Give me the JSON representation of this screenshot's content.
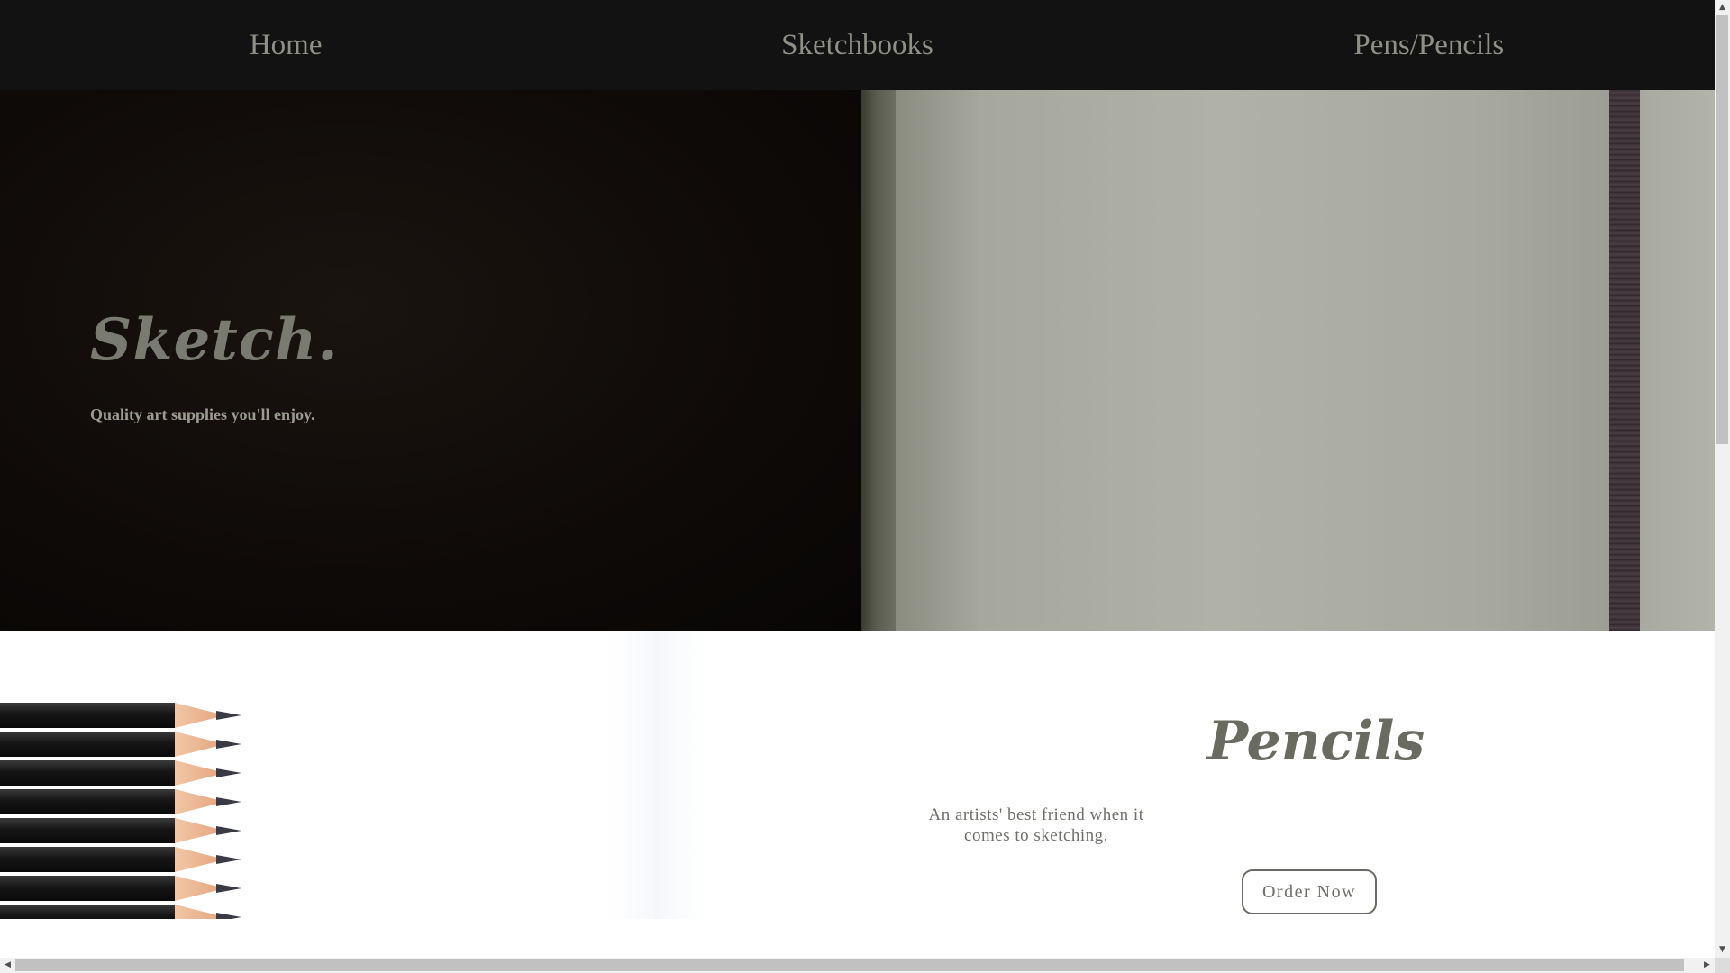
{
  "nav": {
    "items": [
      {
        "label": "Home"
      },
      {
        "label": "Sketchbooks"
      },
      {
        "label": "Pens/Pencils"
      }
    ]
  },
  "hero": {
    "title": "Sketch.",
    "subtitle": "Quality art supplies you'll enjoy."
  },
  "product": {
    "title": "Pencils",
    "description": "An artists' best friend when it comes to sketching.",
    "button_label": "Order Now"
  },
  "icons": {
    "hero_image": "sketchbook-photo",
    "product_image": "pencils-photo",
    "scroll_up": "arrow-up-icon",
    "scroll_down": "arrow-down-icon",
    "scroll_left": "arrow-left-icon",
    "scroll_right": "arrow-right-icon"
  },
  "colors": {
    "nav_background": "#121212",
    "nav_text": "#8f8f86",
    "title_text": "#6a6b60",
    "body_text": "#6f6f6a"
  }
}
